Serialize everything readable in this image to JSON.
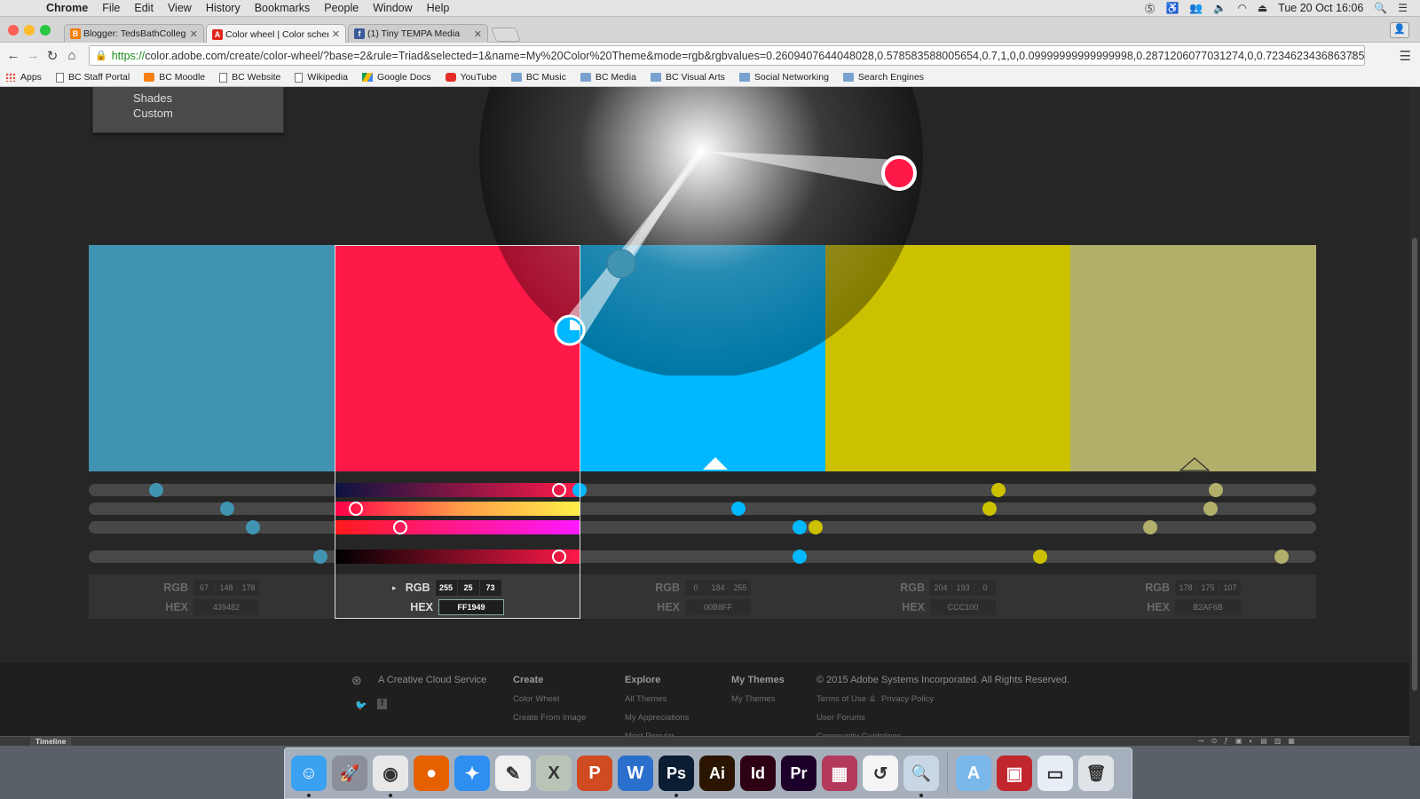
{
  "menubar": {
    "app": "Chrome",
    "items": [
      "File",
      "Edit",
      "View",
      "History",
      "Bookmarks",
      "People",
      "Window",
      "Help"
    ],
    "clock": "Tue 20 Oct  16:06"
  },
  "tabs": [
    {
      "title": "Blogger: TedsBathCollegeI",
      "favicon_color": "#f57d00",
      "glyph": "B"
    },
    {
      "title": "Color wheel | Color schem",
      "favicon_color": "#e1251b",
      "glyph": "A"
    },
    {
      "title": "(1) Tiny TEMPA Media",
      "favicon_color": "#3b5998",
      "glyph": "f"
    }
  ],
  "omnibox": {
    "scheme": "https://",
    "rest": "color.adobe.com/create/color-wheel/?base=2&rule=Triad&selected=1&name=My%20Color%20Theme&mode=rgb&rgbvalues=0.2609407644048028,0.578583588005654,0.7,1,0,0.09999999999999998,0.2871206077031274,0,0.7234623436863785,1,0.8,0...."
  },
  "bookmarks": [
    {
      "label": "Apps",
      "icon": "grid"
    },
    {
      "label": "BC Staff Portal",
      "icon": "page"
    },
    {
      "label": "BC Moodle",
      "icon": "moodle"
    },
    {
      "label": "BC Website",
      "icon": "page"
    },
    {
      "label": "Wikipedia",
      "icon": "page"
    },
    {
      "label": "Google Docs",
      "icon": "gd"
    },
    {
      "label": "YouTube",
      "icon": "yt"
    },
    {
      "label": "BC Music",
      "icon": "folder"
    },
    {
      "label": "BC Media",
      "icon": "folder"
    },
    {
      "label": "BC Visual Arts",
      "icon": "folder"
    },
    {
      "label": "Social Networking",
      "icon": "folder"
    },
    {
      "label": "Search Engines",
      "icon": "folder"
    }
  ],
  "rule_menu": {
    "items": [
      "Shades",
      "Custom"
    ]
  },
  "theme": {
    "selected_index": 1,
    "swatches": [
      {
        "hex_color": "#439482",
        "rgb": [
          "67",
          "148",
          "178"
        ],
        "hex": "439482",
        "display": "#4193b2"
      },
      {
        "hex_color": "#FF1949",
        "rgb": [
          "255",
          "25",
          "73"
        ],
        "hex": "FF1949",
        "display": "#ff1949"
      },
      {
        "hex_color": "#00B8FF",
        "rgb": [
          "0",
          "184",
          "255"
        ],
        "hex": "00B8FF",
        "display": "#00b8ff"
      },
      {
        "hex_color": "#CCC100",
        "rgb": [
          "204",
          "193",
          "0"
        ],
        "hex": "CCC100",
        "display": "#ccc100"
      },
      {
        "hex_color": "#B2AF6B",
        "rgb": [
          "178",
          "175",
          "107"
        ],
        "hex": "B2AF6B",
        "display": "#b2af6b"
      }
    ],
    "labels": {
      "rgb": "RGB",
      "hex": "HEX"
    }
  },
  "sliders": {
    "rows": [
      {
        "knobs": [
          {
            "pos": 0.055,
            "color": "#4193b2"
          },
          {
            "pos": 0.383,
            "color": "#ffffff",
            "white": true
          },
          {
            "pos": 0.4,
            "color": "#00b8ff"
          },
          {
            "pos": 0.741,
            "color": "#ccc100"
          },
          {
            "pos": 0.918,
            "color": "#b2af6b"
          }
        ]
      },
      {
        "knobs": [
          {
            "pos": 0.113,
            "color": "#4193b2"
          },
          {
            "pos": 0.218,
            "color": "#ffffff",
            "white": true
          },
          {
            "pos": 0.529,
            "color": "#00b8ff"
          },
          {
            "pos": 0.734,
            "color": "#ccc100"
          },
          {
            "pos": 0.914,
            "color": "#b2af6b"
          }
        ]
      },
      {
        "knobs": [
          {
            "pos": 0.134,
            "color": "#4193b2"
          },
          {
            "pos": 0.254,
            "color": "#ffffff",
            "white": true
          },
          {
            "pos": 0.579,
            "color": "#00b8ff"
          },
          {
            "pos": 0.592,
            "color": "#ccc100"
          },
          {
            "pos": 0.865,
            "color": "#b2af6b"
          }
        ]
      },
      {
        "knobs": [
          {
            "pos": 0.189,
            "color": "#4193b2"
          },
          {
            "pos": 0.383,
            "color": "#ffffff",
            "white": true
          },
          {
            "pos": 0.579,
            "color": "#00b8ff"
          },
          {
            "pos": 0.775,
            "color": "#ccc100"
          },
          {
            "pos": 0.972,
            "color": "#b2af6b"
          }
        ]
      }
    ]
  },
  "footer": {
    "cc": "A Creative Cloud Service",
    "create": {
      "head": "Create",
      "links": [
        "Color Wheel",
        "Create From Image"
      ]
    },
    "explore": {
      "head": "Explore",
      "links": [
        "All Themes",
        "My Appreciations",
        "Most Popular"
      ]
    },
    "mythemes": {
      "head": "My Themes",
      "links": [
        "My Themes"
      ]
    },
    "legal": {
      "head": "© 2015 Adobe Systems Incorporated. All Rights Reserved.",
      "terms": "Terms of Use",
      "amp": "&",
      "privacy": "Privacy Policy",
      "forums": "User Forums",
      "community": "Community Guidelines"
    }
  },
  "timeline": {
    "label": "Timeline"
  },
  "dock": [
    {
      "name": "finder-icon",
      "bg": "#3aa0f0",
      "glyph": "☺",
      "dot": true
    },
    {
      "name": "launchpad-icon",
      "bg": "#8a8f99",
      "glyph": "🚀",
      "dot": false
    },
    {
      "name": "chrome-icon",
      "bg": "#e8e8e8",
      "glyph": "◉",
      "dot": true
    },
    {
      "name": "firefox-icon",
      "bg": "#e66000",
      "glyph": "●",
      "dot": false
    },
    {
      "name": "safari-icon",
      "bg": "#2f8ef2",
      "glyph": "✦",
      "dot": false
    },
    {
      "name": "textedit-icon",
      "bg": "#f0f0f0",
      "glyph": "✎",
      "dot": false
    },
    {
      "name": "excel-icon",
      "bg": "#b8c4b6",
      "glyph": "X",
      "dot": false
    },
    {
      "name": "powerpoint-icon",
      "bg": "#d04a22",
      "glyph": "P",
      "dot": false
    },
    {
      "name": "word-icon",
      "bg": "#2b6fcc",
      "glyph": "W",
      "dot": false
    },
    {
      "name": "photoshop-icon",
      "bg": "#0b1d33",
      "glyph": "Ps",
      "dot": true
    },
    {
      "name": "illustrator-icon",
      "bg": "#2b1500",
      "glyph": "Ai",
      "dot": false
    },
    {
      "name": "indesign-icon",
      "bg": "#2d0014",
      "glyph": "Id",
      "dot": false
    },
    {
      "name": "premiere-icon",
      "bg": "#1c0029",
      "glyph": "Pr",
      "dot": false
    },
    {
      "name": "photo-booth-icon",
      "bg": "#b33a5a",
      "glyph": "▦",
      "dot": false
    },
    {
      "name": "upload-app-icon",
      "bg": "#f4f4f4",
      "glyph": "↺",
      "dot": false
    },
    {
      "name": "preview-icon",
      "bg": "#c9d6e6",
      "glyph": "🔍",
      "dot": true
    },
    {
      "name": "applications-folder-icon",
      "bg": "#7ab7ea",
      "glyph": "A",
      "dot": false
    },
    {
      "name": "red-app-icon",
      "bg": "#c0262c",
      "glyph": "▣",
      "dot": false
    },
    {
      "name": "downloads-stack-icon",
      "bg": "#e8eef5",
      "glyph": "▭",
      "dot": false
    },
    {
      "name": "trash-icon",
      "bg": "#dfe3e8",
      "glyph": "🗑",
      "dot": false
    }
  ]
}
